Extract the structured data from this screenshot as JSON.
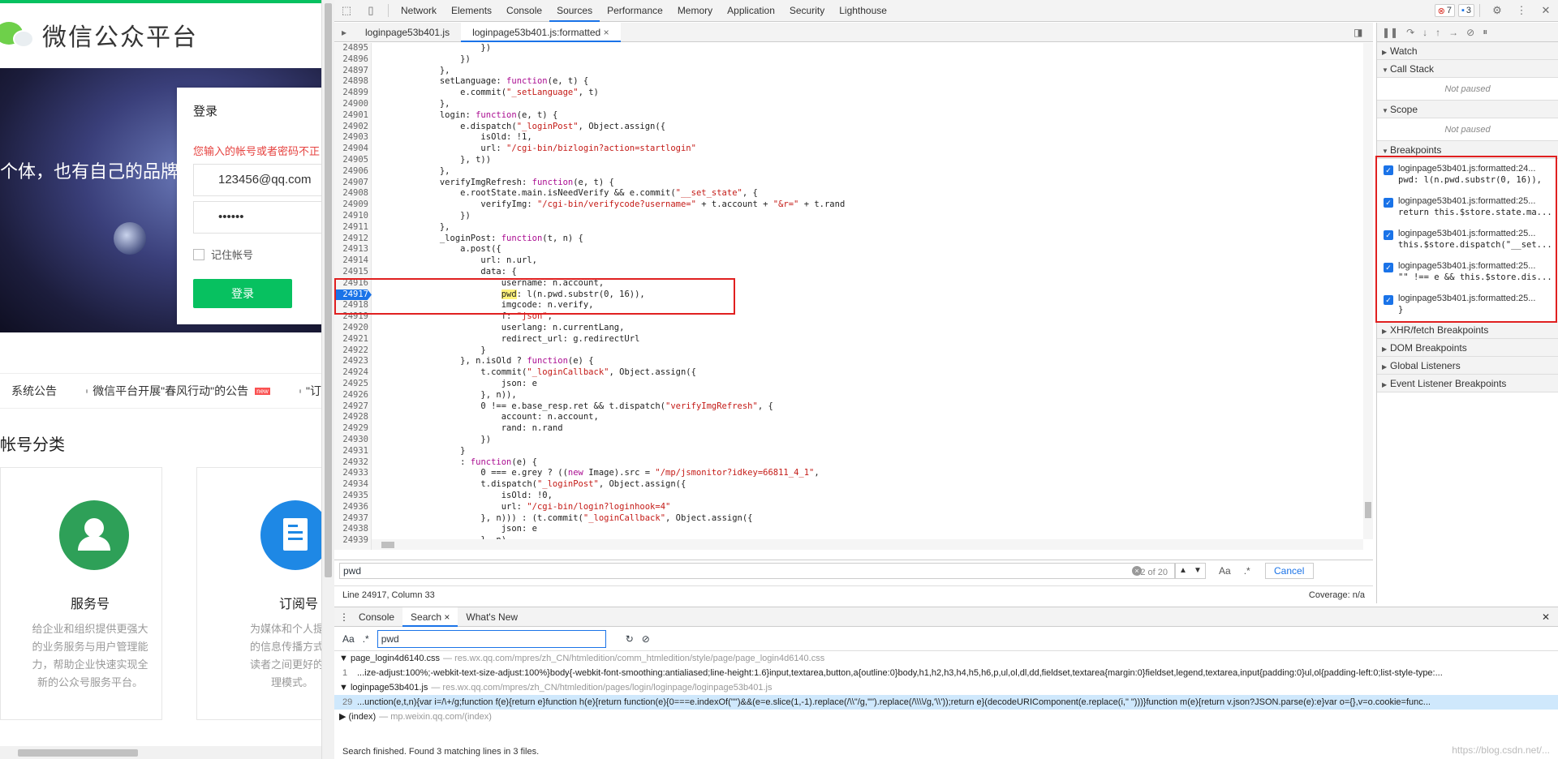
{
  "page": {
    "logo_text": "微信公众平台",
    "slogan": "个体，也有自己的品牌",
    "login": {
      "title": "登录",
      "error": "您输入的帐号或者密码不正",
      "account": "123456@qq.com",
      "password": "••••••",
      "remember": "记住帐号",
      "button": "登录"
    },
    "notices": {
      "item1": "系统公告",
      "item2": "微信平台开展\"春风行动\"的公告",
      "item2_badge": "new",
      "item3": "\"订"
    },
    "account_types_title": "帐号分类",
    "cards": [
      {
        "name": "服务号",
        "desc": [
          "给企业和组织提供更强大",
          "的业务服务与用户管理能",
          "力，帮助企业快速实现全",
          "新的公众号服务平台。"
        ]
      },
      {
        "name": "订阅号",
        "desc": [
          "为媒体和个人提供",
          "的信息传播方式，",
          "读者之间更好的沟",
          "理模式。"
        ]
      }
    ]
  },
  "devtools": {
    "tabs": [
      "Network",
      "Elements",
      "Console",
      "Sources",
      "Performance",
      "Memory",
      "Application",
      "Security",
      "Lighthouse"
    ],
    "active_tab": "Sources",
    "errors": "7",
    "messages": "3",
    "files": [
      "loginpage53b401.js",
      "loginpage53b401.js:formatted"
    ],
    "code_lines": [
      {
        "n": "24895",
        "t": "                    })"
      },
      {
        "n": "24896",
        "t": "                })"
      },
      {
        "n": "24897",
        "t": "            },"
      },
      {
        "n": "24898",
        "t": "            setLanguage: function(e, t) {"
      },
      {
        "n": "24899",
        "t": "                e.commit(\"_setLanguage\", t)"
      },
      {
        "n": "24900",
        "t": "            },"
      },
      {
        "n": "24901",
        "t": "            login: function(e, t) {"
      },
      {
        "n": "24902",
        "t": "                e.dispatch(\"_loginPost\", Object.assign({"
      },
      {
        "n": "24903",
        "t": "                    isOld: !1,"
      },
      {
        "n": "24904",
        "t": "                    url: \"/cgi-bin/bizlogin?action=startlogin\""
      },
      {
        "n": "24905",
        "t": "                }, t))"
      },
      {
        "n": "24906",
        "t": "            },"
      },
      {
        "n": "24907",
        "t": "            verifyImgRefresh: function(e, t) {"
      },
      {
        "n": "24908",
        "t": "                e.rootState.main.isNeedVerify && e.commit(\"__set_state\", {"
      },
      {
        "n": "24909",
        "t": "                    verifyImg: \"/cgi-bin/verifycode?username=\" + t.account + \"&r=\" + t.rand"
      },
      {
        "n": "24910",
        "t": "                })"
      },
      {
        "n": "24911",
        "t": "            },"
      },
      {
        "n": "24912",
        "t": "            _loginPost: function(t, n) {"
      },
      {
        "n": "24913",
        "t": "                a.post({"
      },
      {
        "n": "24914",
        "t": "                    url: n.url,"
      },
      {
        "n": "24915",
        "t": "                    data: {"
      },
      {
        "n": "24916",
        "t": "                        username: n.account,"
      },
      {
        "n": "24917",
        "t": "                        pwd: l(n.pwd.substr(0, 16)),"
      },
      {
        "n": "24918",
        "t": "                        imgcode: n.verify,"
      },
      {
        "n": "24919",
        "t": "                        f: \"json\","
      },
      {
        "n": "24920",
        "t": "                        userlang: n.currentLang,"
      },
      {
        "n": "24921",
        "t": "                        redirect_url: g.redirectUrl"
      },
      {
        "n": "24922",
        "t": "                    }"
      },
      {
        "n": "24923",
        "t": "                }, n.isOld ? function(e) {"
      },
      {
        "n": "24924",
        "t": "                    t.commit(\"_loginCallback\", Object.assign({"
      },
      {
        "n": "24925",
        "t": "                        json: e"
      },
      {
        "n": "24926",
        "t": "                    }, n)),"
      },
      {
        "n": "24927",
        "t": "                    0 !== e.base_resp.ret && t.dispatch(\"verifyImgRefresh\", {"
      },
      {
        "n": "24928",
        "t": "                        account: n.account,"
      },
      {
        "n": "24929",
        "t": "                        rand: n.rand"
      },
      {
        "n": "24930",
        "t": "                    })"
      },
      {
        "n": "24931",
        "t": "                }"
      },
      {
        "n": "24932",
        "t": "                : function(e) {"
      },
      {
        "n": "24933",
        "t": "                    0 === e.grey ? ((new Image).src = \"/mp/jsmonitor?idkey=66811_4_1\","
      },
      {
        "n": "24934",
        "t": "                    t.dispatch(\"_loginPost\", Object.assign({"
      },
      {
        "n": "24935",
        "t": "                        isOld: !0,"
      },
      {
        "n": "24936",
        "t": "                        url: \"/cgi-bin/login?loginhook=4\""
      },
      {
        "n": "24937",
        "t": "                    }, n))) : (t.commit(\"_loginCallback\", Object.assign({"
      },
      {
        "n": "24938",
        "t": "                        json: e"
      },
      {
        "n": "24939",
        "t": "                    }, n),"
      }
    ],
    "find": {
      "query": "pwd",
      "count": "2 of 20",
      "match_case": "Aa",
      "regex": ".*",
      "cancel": "Cancel"
    },
    "status": {
      "position": "Line 24917, Column 33",
      "coverage": "Coverage: n/a"
    },
    "sidebar": {
      "watch": "Watch",
      "call_stack": "Call Stack",
      "not_paused": "Not paused",
      "scope": "Scope",
      "breakpoints": "Breakpoints",
      "bp_list": [
        {
          "file": "loginpage53b401.js:formatted:24...",
          "code": "pwd: l(n.pwd.substr(0, 16)),"
        },
        {
          "file": "loginpage53b401.js:formatted:25...",
          "code": "return this.$store.state.ma..."
        },
        {
          "file": "loginpage53b401.js:formatted:25...",
          "code": "this.$store.dispatch(\"__set..."
        },
        {
          "file": "loginpage53b401.js:formatted:25...",
          "code": "\"\" !== e && this.$store.dis..."
        },
        {
          "file": "loginpage53b401.js:formatted:25...",
          "code": "}"
        }
      ],
      "xhr": "XHR/fetch Breakpoints",
      "dom": "DOM Breakpoints",
      "global": "Global Listeners",
      "event": "Event Listener Breakpoints"
    },
    "drawer": {
      "tabs": [
        "Console",
        "Search",
        "What's New"
      ],
      "search_value": "pwd",
      "results": [
        {
          "file": "page_login4d6140.css",
          "path": "— res.wx.qq.com/mpres/zh_CN/htmledition/comm_htmledition/style/page/page_login4d6140.css",
          "line_no": "1",
          "line": "...ize-adjust:100%;-webkit-text-size-adjust:100%}body{-webkit-font-smoothing:antialiased;line-height:1.6}input,textarea,button,a{outline:0}body,h1,h2,h3,h4,h5,h6,p,ul,ol,dl,dd,fieldset,textarea{margin:0}fieldset,legend,textarea,input{padding:0}ul,ol{padding-left:0;list-style-type:..."
        },
        {
          "file": "loginpage53b401.js",
          "path": "— res.wx.qq.com/mpres/zh_CN/htmledition/pages/login/loginpage/loginpage53b401.js",
          "line_no": "29",
          "line": "...unction(e,t,n){var i=/\\+/g;function f(e){return e}function h(e){return function(e){0===e.indexOf('\"')&&(e=e.slice(1,-1).replace(/\\\\\"/g,'\"').replace(/\\\\\\\\/g,'\\\\'));return e}(decodeURIComponent(e.replace(i,\" \")))}function m(e){return v.json?JSON.parse(e):e}var o={},v=o.cookie=func..."
        },
        {
          "file": "(index)",
          "path": "— mp.weixin.qq.com/(index)"
        }
      ],
      "status": "Search finished.  Found 3 matching lines in 3 files.",
      "watermark": "https://blog.csdn.net/..."
    }
  }
}
